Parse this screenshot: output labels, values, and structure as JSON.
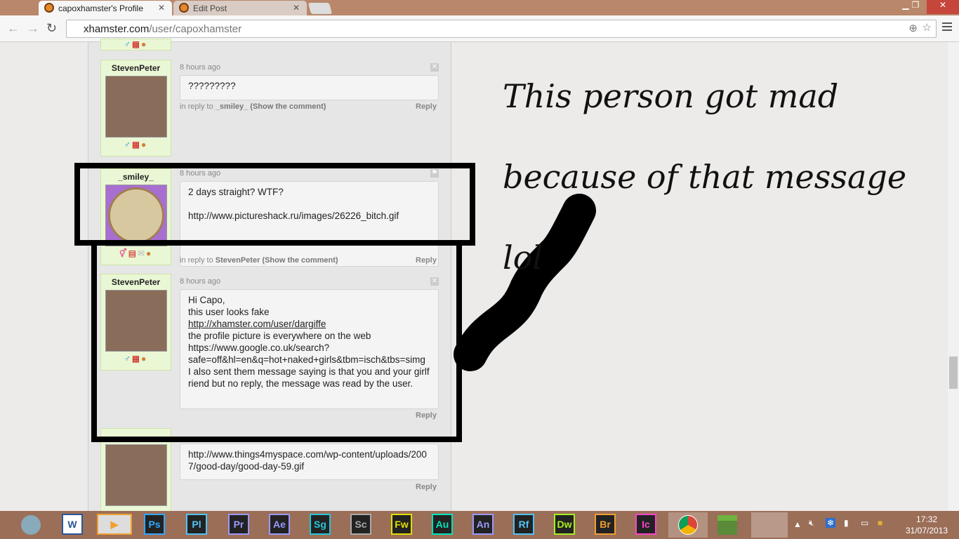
{
  "browser": {
    "tabs": [
      {
        "label": "capoxhamster's Profile"
      },
      {
        "label": "Edit Post"
      }
    ],
    "url_domain": "xhamster.com",
    "url_path": "/user/capoxhamster"
  },
  "comments": [
    {
      "user": "StevenPeter",
      "time": "8 hours ago",
      "text": "?????????",
      "reply_prefix": "in reply to",
      "reply_to": "_smiley_ (Show the comment)",
      "reply": "Reply"
    },
    {
      "user": "_smiley_",
      "time": "8 hours ago",
      "text": "2 days straight? WTF?\n\nhttp://www.pictureshack.ru/images/26226_bitch.gif\n\n.........................",
      "reply_prefix": "in reply to",
      "reply_to": "StevenPeter (Show the comment)",
      "reply": "Reply"
    },
    {
      "user": "StevenPeter",
      "time": "8 hours ago",
      "text_1": "Hi Capo,\nthis user looks fake",
      "link": "http://xhamster.com/user/dargiffe",
      "text_2": "the profile picture is everywhere on the web\nhttps://www.google.co.uk/search?\nsafe=off&hl=en&q=hot+naked+girls&tbm=isch&tbs=simg\nI also sent them message saying is that you and your girlfriend but no reply, the message was read by the user.",
      "reply": "Reply"
    },
    {
      "text": "http://www.things4myspace.com/wp-content/uploads/2007/good-day/good-day-59.gif",
      "reply": "Reply"
    }
  ],
  "annotation": "This person got mad because of that message lol",
  "taskbar": {
    "apps": [
      {
        "label": "W",
        "color": "#2b5797"
      },
      {
        "label": "▶",
        "color": "#f0a030"
      },
      {
        "label": "Ps",
        "color": "#31a8ff"
      },
      {
        "label": "Pl",
        "color": "#4fc3f7"
      },
      {
        "label": "Pr",
        "color": "#9999ff"
      },
      {
        "label": "Ae",
        "color": "#9999ff"
      },
      {
        "label": "Sg",
        "color": "#26c6da"
      },
      {
        "label": "Sc",
        "color": "#aaaaaa"
      },
      {
        "label": "Fw",
        "color": "#e0e000"
      },
      {
        "label": "Au",
        "color": "#00e4bb"
      },
      {
        "label": "An",
        "color": "#9999ff"
      },
      {
        "label": "Rf",
        "color": "#4fc3f7"
      },
      {
        "label": "Dw",
        "color": "#aaee22"
      },
      {
        "label": "Br",
        "color": "#f0a030"
      },
      {
        "label": "Ic",
        "color": "#ff44cc"
      }
    ],
    "time": "17:32",
    "date": "31/07/2013"
  }
}
